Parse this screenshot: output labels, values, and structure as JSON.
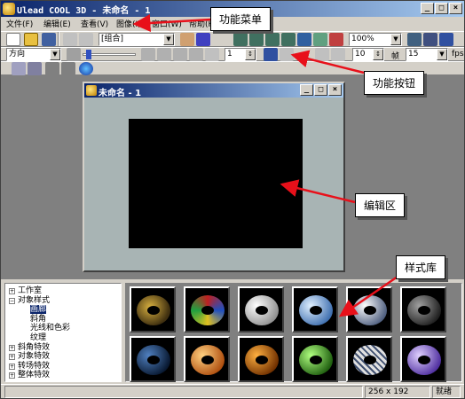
{
  "window": {
    "title": "Ulead COOL 3D - 未命名 - 1"
  },
  "menu": {
    "items": [
      "文件(F)",
      "编辑(E)",
      "查看(V)",
      "图像(I)",
      "窗口(W)",
      "帮助(H)"
    ]
  },
  "toolbar": {
    "object_select": "[组合]",
    "zoom": "100%",
    "direction": "方向",
    "value1": "1",
    "value2": "10",
    "frame_label": "帧",
    "frame_value": "15",
    "fps_label": "fps"
  },
  "document": {
    "title": "未命名 - 1"
  },
  "tree": {
    "items": [
      {
        "label": "工作室",
        "expander": "+"
      },
      {
        "label": "对象样式",
        "expander": "−"
      },
      {
        "label": "画廊",
        "expander": ""
      },
      {
        "label": "斜角",
        "expander": ""
      },
      {
        "label": "光线和色彩",
        "expander": ""
      },
      {
        "label": "纹理",
        "expander": ""
      },
      {
        "label": "斜角特效",
        "expander": "+"
      },
      {
        "label": "对象特效",
        "expander": "+"
      },
      {
        "label": "转场特效",
        "expander": "+"
      },
      {
        "label": "整体特效",
        "expander": "+"
      }
    ]
  },
  "gallery": {
    "thumbs": [
      {
        "icon": "gold-speckle-torus"
      },
      {
        "icon": "stained-glass-torus"
      },
      {
        "icon": "white-marble-torus"
      },
      {
        "icon": "blue-sky-torus"
      },
      {
        "icon": "silver-text-torus"
      },
      {
        "icon": "dark-steel-torus"
      },
      {
        "icon": "dark-blue-torus"
      },
      {
        "icon": "orange-torus"
      },
      {
        "icon": "amber-torus"
      },
      {
        "icon": "green-torus"
      },
      {
        "icon": "newsprint-torus"
      },
      {
        "icon": "violet-torus"
      }
    ]
  },
  "status": {
    "size": "256 x 192",
    "mode": "就绪"
  },
  "annotations": {
    "menu_label": "功能菜单",
    "buttons_label": "功能按钮",
    "edit_area_label": "编辑区",
    "style_library_label": "样式库",
    "arrow_color": "#e8101a"
  },
  "colors": {
    "canvas": "#000000",
    "workspace": "#808080",
    "document_bg": "#a8b4b4",
    "title_active": "#0a246a"
  }
}
